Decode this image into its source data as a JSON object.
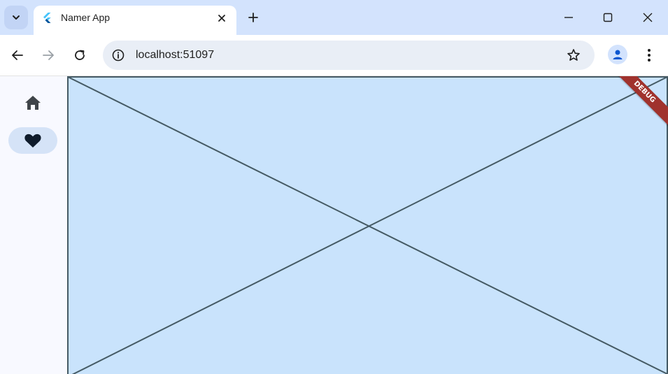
{
  "browser": {
    "tab": {
      "title": "Namer App",
      "favicon": "flutter-logo-icon"
    },
    "new_tab_icon": "plus-icon",
    "tab_search_icon": "chevron-down-icon",
    "window_controls": [
      "minimize-icon",
      "maximize-icon",
      "close-icon"
    ],
    "address_bar": {
      "url": "localhost:51097",
      "site_info_icon": "info-icon",
      "bookmark_icon": "star-icon"
    },
    "colors": {
      "tabstrip": "#d3e3fd",
      "omnibox": "#e9eef6"
    }
  },
  "app": {
    "navigation_rail": {
      "destinations": [
        {
          "icon": "home-icon",
          "selected": false
        },
        {
          "icon": "favorite-heart-icon",
          "selected": true
        }
      ],
      "indicator_color": "#d5e3f7"
    },
    "content": {
      "type": "placeholder",
      "background": "#c9e3fc",
      "stroke": "#455a64"
    },
    "debug_banner": "DEBUG",
    "debug_banner_color": "#a0322d"
  }
}
